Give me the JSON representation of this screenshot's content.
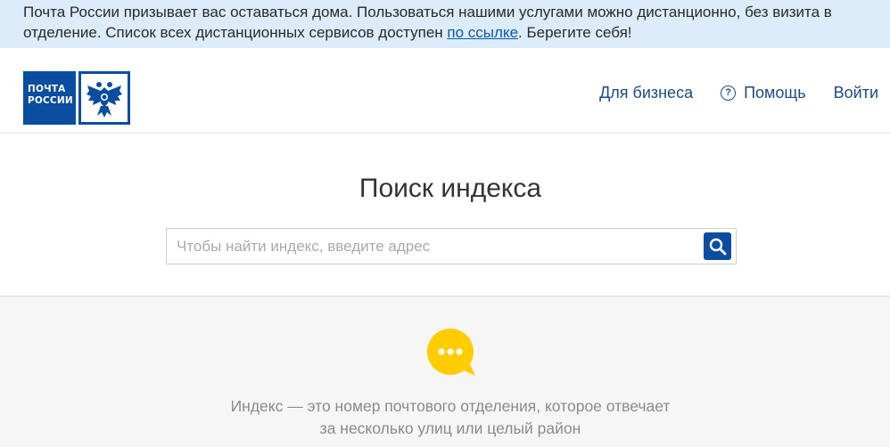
{
  "banner": {
    "text_before": "Почта России призывает вас оставаться дома. Пользоваться нашими услугами можно дистанционно, без визита в отделение. Список всех дистанционных сервисов доступен ",
    "link_text": "по ссылке",
    "text_after": ". Берегите себя!"
  },
  "header": {
    "logo_line1": "ПОЧТА",
    "logo_line2": "РОССИИ",
    "nav": {
      "business": "Для бизнеса",
      "help": "Помощь",
      "help_icon_glyph": "?",
      "login": "Войти"
    }
  },
  "search": {
    "title": "Поиск индекса",
    "placeholder": "Чтобы найти индекс, введите адрес",
    "value": ""
  },
  "info": {
    "line1": "Индекс — это номер почтового отделения, которое отвечает",
    "line2": "за несколько улиц или целый район"
  },
  "colors": {
    "brand_blue": "#0b4da0",
    "banner_bg": "#dcecfb",
    "nav_text": "#1c4a86",
    "chat_yellow": "#ffcc00"
  }
}
